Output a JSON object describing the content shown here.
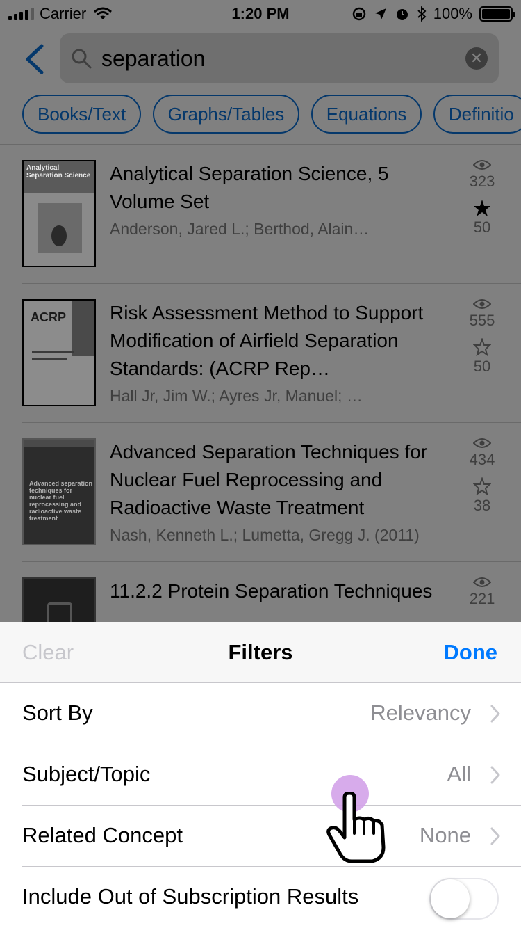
{
  "status_bar": {
    "carrier": "Carrier",
    "time": "1:20 PM",
    "battery_pct": "100%",
    "battery_level": 1.0
  },
  "search": {
    "query": "separation",
    "back_icon": "chevron-left-icon",
    "search_icon": "magnifier-icon",
    "clear_icon": "clear-x-icon"
  },
  "chips": [
    "Books/Text",
    "Graphs/Tables",
    "Equations",
    "Definitio"
  ],
  "results": [
    {
      "title": "Analytical Separation Science, 5 Volume Set",
      "authors": "Anderson, Jared L.; Berthod, Alain…",
      "views": "323",
      "favorites": "50",
      "favorited": true,
      "cover_text": "Analytical Separation Science"
    },
    {
      "title": "Risk Assessment Method to Support Modification of Airfield Separation Standards: (ACRP Rep…",
      "authors": "Hall Jr, Jim W.; Ayres Jr, Manuel; …",
      "views": "555",
      "favorites": "50",
      "favorited": false,
      "cover_text": "ACRP"
    },
    {
      "title": "Advanced Separation Techniques for Nuclear Fuel Reprocessing and Radioactive Waste Treatment",
      "authors": "Nash, Kenneth L.; Lumetta, Gregg J. (2011)",
      "views": "434",
      "favorites": "38",
      "favorited": false,
      "cover_text": "Advanced separation techniques for nuclear fuel reprocessing and radioactive waste treatment"
    },
    {
      "title": "11.2.2 Protein Separation Techniques",
      "authors": "",
      "views": "221",
      "favorites": "",
      "favorited": false,
      "cover_text": ""
    }
  ],
  "filters": {
    "clear_label": "Clear",
    "title": "Filters",
    "done_label": "Done",
    "rows": [
      {
        "label": "Sort By",
        "value": "Relevancy"
      },
      {
        "label": "Subject/Topic",
        "value": "All"
      },
      {
        "label": "Related Concept",
        "value": "None"
      }
    ],
    "toggle_label": "Include Out of Subscription Results",
    "toggle_on": false
  },
  "colors": {
    "accent": "#007aff",
    "overlay": "#808080",
    "chip": "#05386b",
    "touch": "#d3a2e9"
  }
}
